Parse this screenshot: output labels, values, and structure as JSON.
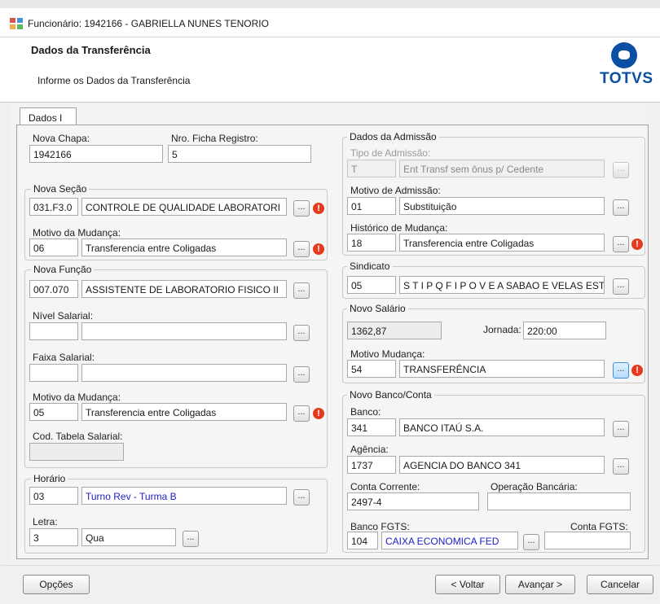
{
  "window": {
    "title": "Funcionário: 1942166 - GABRIELLA NUNES TENORIO"
  },
  "header": {
    "title": "Dados da Transferência",
    "subtitle": "Informe os Dados da Transferência",
    "logo_text": "TOTVS"
  },
  "tab": {
    "label": "Dados I"
  },
  "left": {
    "nova_chapa": {
      "label": "Nova Chapa:",
      "value": "1942166"
    },
    "ficha": {
      "label": "Nro. Ficha Registro:",
      "value": "5"
    },
    "nova_secao": {
      "title": "Nova Seção",
      "code": "031.F3.0",
      "desc": "CONTROLE DE QUALIDADE LABORATORI",
      "motivo_label": "Motivo da Mudança:",
      "motivo_code": "06",
      "motivo_desc": "Transferencia entre Coligadas"
    },
    "nova_funcao": {
      "title": "Nova Função",
      "code": "007.070",
      "desc": "ASSISTENTE DE LABORATORIO FISICO II",
      "nivel_label": "Nível Salarial:",
      "nivel_code": "",
      "nivel_desc": "",
      "faixa_label": "Faixa Salarial:",
      "faixa_code": "",
      "faixa_desc": "",
      "motivo_label": "Motivo da Mudança:",
      "motivo_code": "05",
      "motivo_desc": "Transferencia entre Coligadas",
      "tabela_label": "Cod. Tabela Salarial:",
      "tabela_value": ""
    },
    "horario": {
      "title": "Horário",
      "code": "03",
      "desc": "Turno Rev - Turma B",
      "letra_label": "Letra:",
      "letra_code": "3",
      "letra_desc": "Qua"
    }
  },
  "right": {
    "admissao": {
      "title": "Dados da Admissão",
      "tipo_label": "Tipo de Admissão:",
      "tipo_code": "T",
      "tipo_desc": "Ent Transf sem ônus p/ Cedente",
      "motivo_label": "Motivo de Admissão:",
      "motivo_code": "01",
      "motivo_desc": "Substituição",
      "hist_label": "Histórico de Mudança:",
      "hist_code": "18",
      "hist_desc": "Transferencia entre Coligadas"
    },
    "sindicato": {
      "title": "Sindicato",
      "code": "05",
      "desc": "S T I P Q F I P O V E A SABAO E VELAS EST"
    },
    "salario": {
      "title": "Novo Salário",
      "value": "1362,87",
      "jornada_label": "Jornada:",
      "jornada_value": "220:00",
      "motivo_label": "Motivo Mudança:",
      "motivo_code": "54",
      "motivo_desc": "TRANSFERÊNCIA"
    },
    "banco": {
      "title": "Novo Banco/Conta",
      "banco_label": "Banco:",
      "banco_code": "341",
      "banco_desc": "BANCO ITAÚ S.A.",
      "agencia_label": "Agência:",
      "agencia_code": "1737",
      "agencia_desc": "AGENCIA DO BANCO 341",
      "conta_label": "Conta Corrente:",
      "conta_value": "2497-4",
      "operacao_label": "Operação Bancária:",
      "operacao_value": "",
      "fgts_label": "Banco FGTS:",
      "fgts_code": "104",
      "fgts_desc": "CAIXA ECONOMICA FED",
      "conta_fgts_label": "Conta FGTS:",
      "conta_fgts_value": ""
    }
  },
  "buttons": {
    "lookup": "...",
    "options": "Opções",
    "back": "< Voltar",
    "next": "Avançar >",
    "cancel": "Cancelar"
  },
  "warn_symbol": "!"
}
